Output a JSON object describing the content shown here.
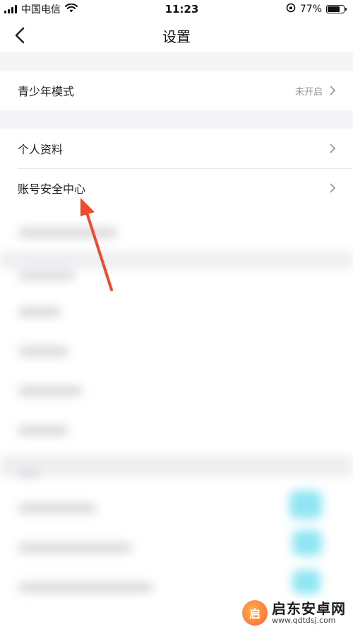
{
  "status_bar": {
    "carrier": "中国电信",
    "time": "11:23",
    "battery": "77%",
    "battery_level": 0.77,
    "icons": [
      "signal-icon",
      "wifi-icon",
      "orientation-lock-icon",
      "battery-icon"
    ]
  },
  "nav": {
    "title": "设置",
    "back_icon": "chevron-left-icon"
  },
  "groups": [
    {
      "rows": [
        {
          "label": "青少年模式",
          "value": "未开启"
        }
      ]
    },
    {
      "rows": [
        {
          "label": "个人资料",
          "value": ""
        },
        {
          "label": "账号安全中心",
          "value": ""
        }
      ]
    }
  ],
  "watermark": {
    "title": "启东安卓网",
    "url": "www.qdtdsj.com"
  },
  "colors": {
    "annotation_arrow": "#f04a2e",
    "background": "#f5f5f7",
    "chevron": "#999999"
  }
}
